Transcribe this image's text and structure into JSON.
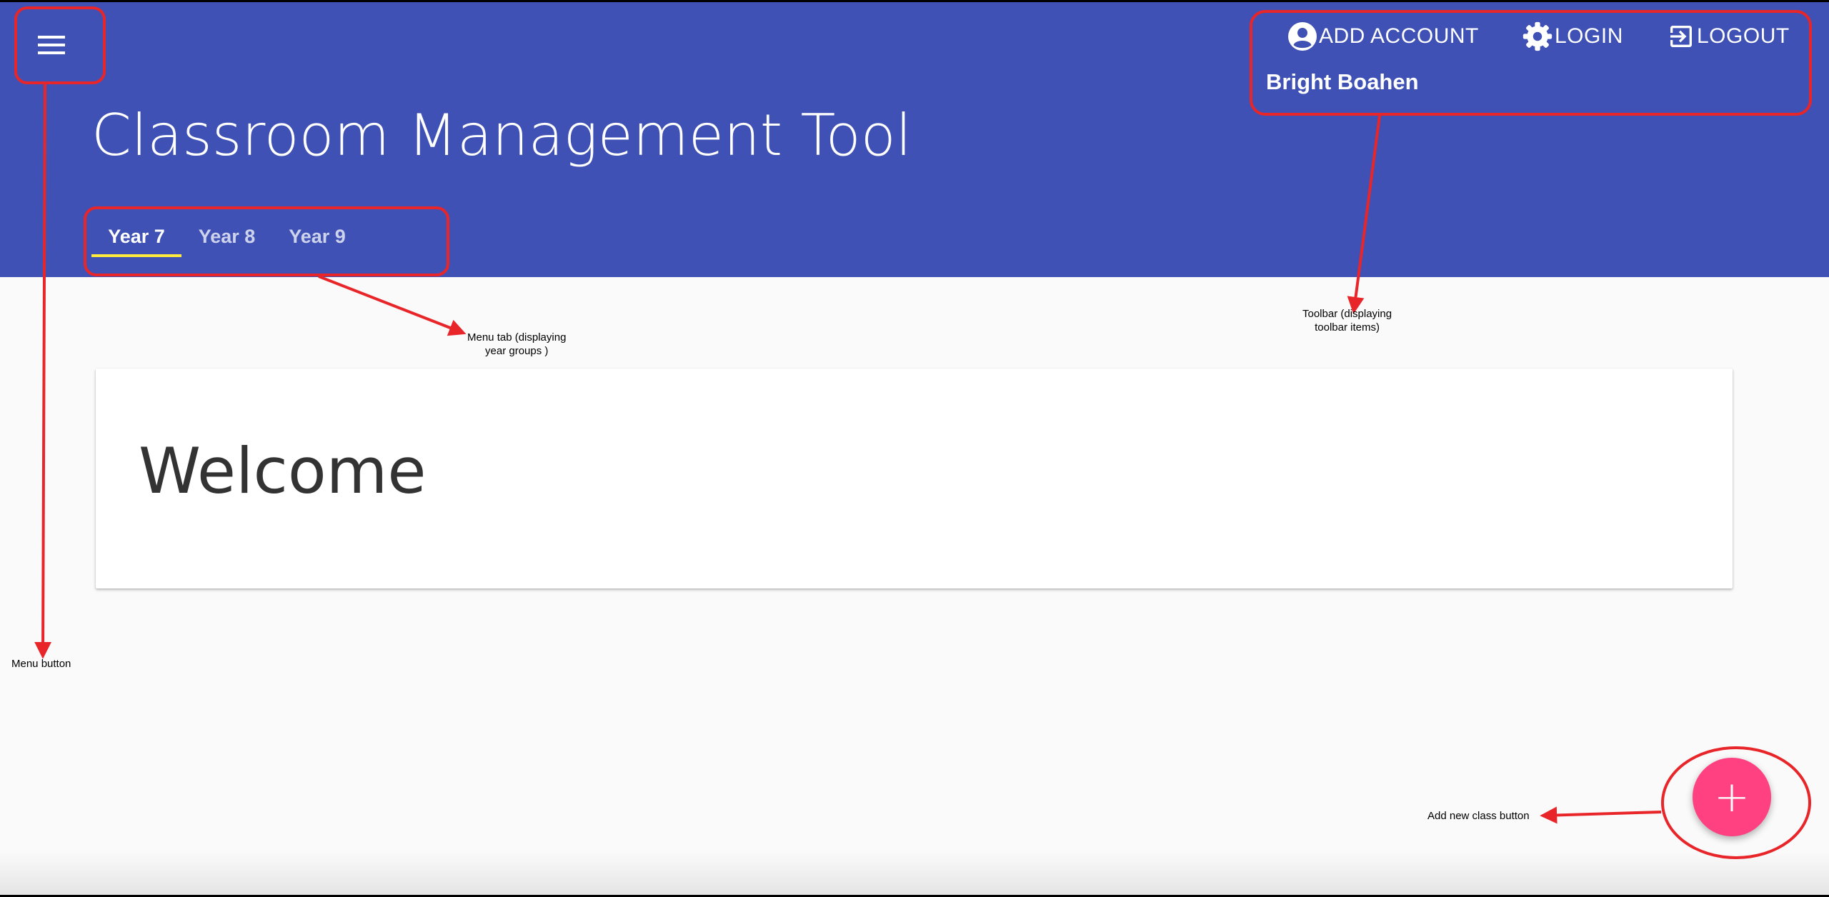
{
  "app": {
    "title": "Classroom Management Tool"
  },
  "tabs": [
    {
      "label": "Year 7",
      "active": true
    },
    {
      "label": "Year 8",
      "active": false
    },
    {
      "label": "Year 9",
      "active": false
    }
  ],
  "toolbar": {
    "add_account_label": "ADD ACCOUNT",
    "login_label": "LOGIN",
    "logout_label": "LOGOUT",
    "user_name": "Bright Boahen"
  },
  "main": {
    "welcome": "Welcome"
  },
  "fab": {
    "symbol": "+"
  },
  "annotations": {
    "menu_tab_line1": "Menu tab (displaying",
    "menu_tab_line2": "year groups )",
    "toolbar_line1": "Toolbar (displaying",
    "toolbar_line2": "toolbar items)",
    "menu_button": "Menu button",
    "add_class_button": "Add new class button"
  },
  "colors": {
    "primary": "#3f51b5",
    "accent": "#ff4081",
    "tab_indicator": "#ffeb3b",
    "annotation": "#e8262a",
    "background": "#fafafa"
  },
  "icons": {
    "menu": "hamburger-menu-icon",
    "add_account": "account-circle-icon",
    "login": "gear-icon",
    "logout": "exit-to-app-icon",
    "fab": "plus-icon"
  }
}
